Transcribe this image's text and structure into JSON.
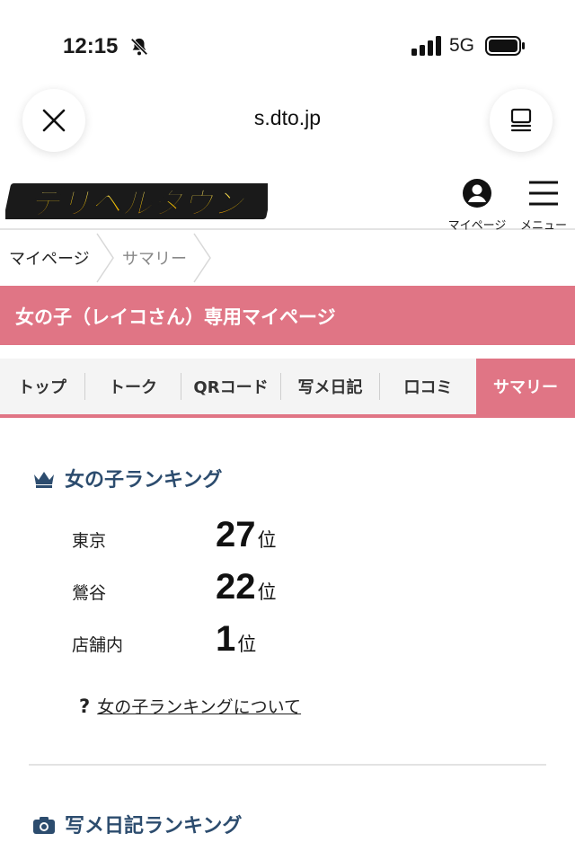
{
  "status_bar": {
    "time": "12:15",
    "network": "5G",
    "icons": [
      "bell-slash-icon",
      "signal-icon",
      "battery-icon"
    ]
  },
  "browser": {
    "url": "s.dto.jp",
    "close_icon": "close-icon",
    "tabs_icon": "tabs-icon"
  },
  "header": {
    "logo_text": "デリヘルタウン",
    "mypage_label": "マイページ",
    "menu_label": "メニュー"
  },
  "breadcrumb": {
    "items": [
      "マイページ",
      "サマリー"
    ]
  },
  "title_band": {
    "text": "女の子（レイコさん）専用マイページ"
  },
  "tabs": [
    {
      "label": "トップ",
      "active": false
    },
    {
      "label": "トーク",
      "active": false
    },
    {
      "label": "QRコード",
      "active": false
    },
    {
      "label": "写メ日記",
      "active": false
    },
    {
      "label": "口コミ",
      "active": false
    },
    {
      "label": "サマリー",
      "active": true
    }
  ],
  "ranking": {
    "title": "女の子ランキング",
    "icon": "crown-icon",
    "rows": [
      {
        "label": "東京",
        "value": "27",
        "suffix": "位"
      },
      {
        "label": "鶯谷",
        "value": "22",
        "suffix": "位"
      },
      {
        "label": "店舗内",
        "value": "1",
        "suffix": "位"
      }
    ],
    "help_mark": "?",
    "about_link": "女の子ランキングについて"
  },
  "photo_diary_ranking": {
    "title": "写メ日記ランキング",
    "icon": "camera-icon"
  },
  "colors": {
    "accent_pink": "#e07585",
    "section_title": "#2c4c6e"
  }
}
